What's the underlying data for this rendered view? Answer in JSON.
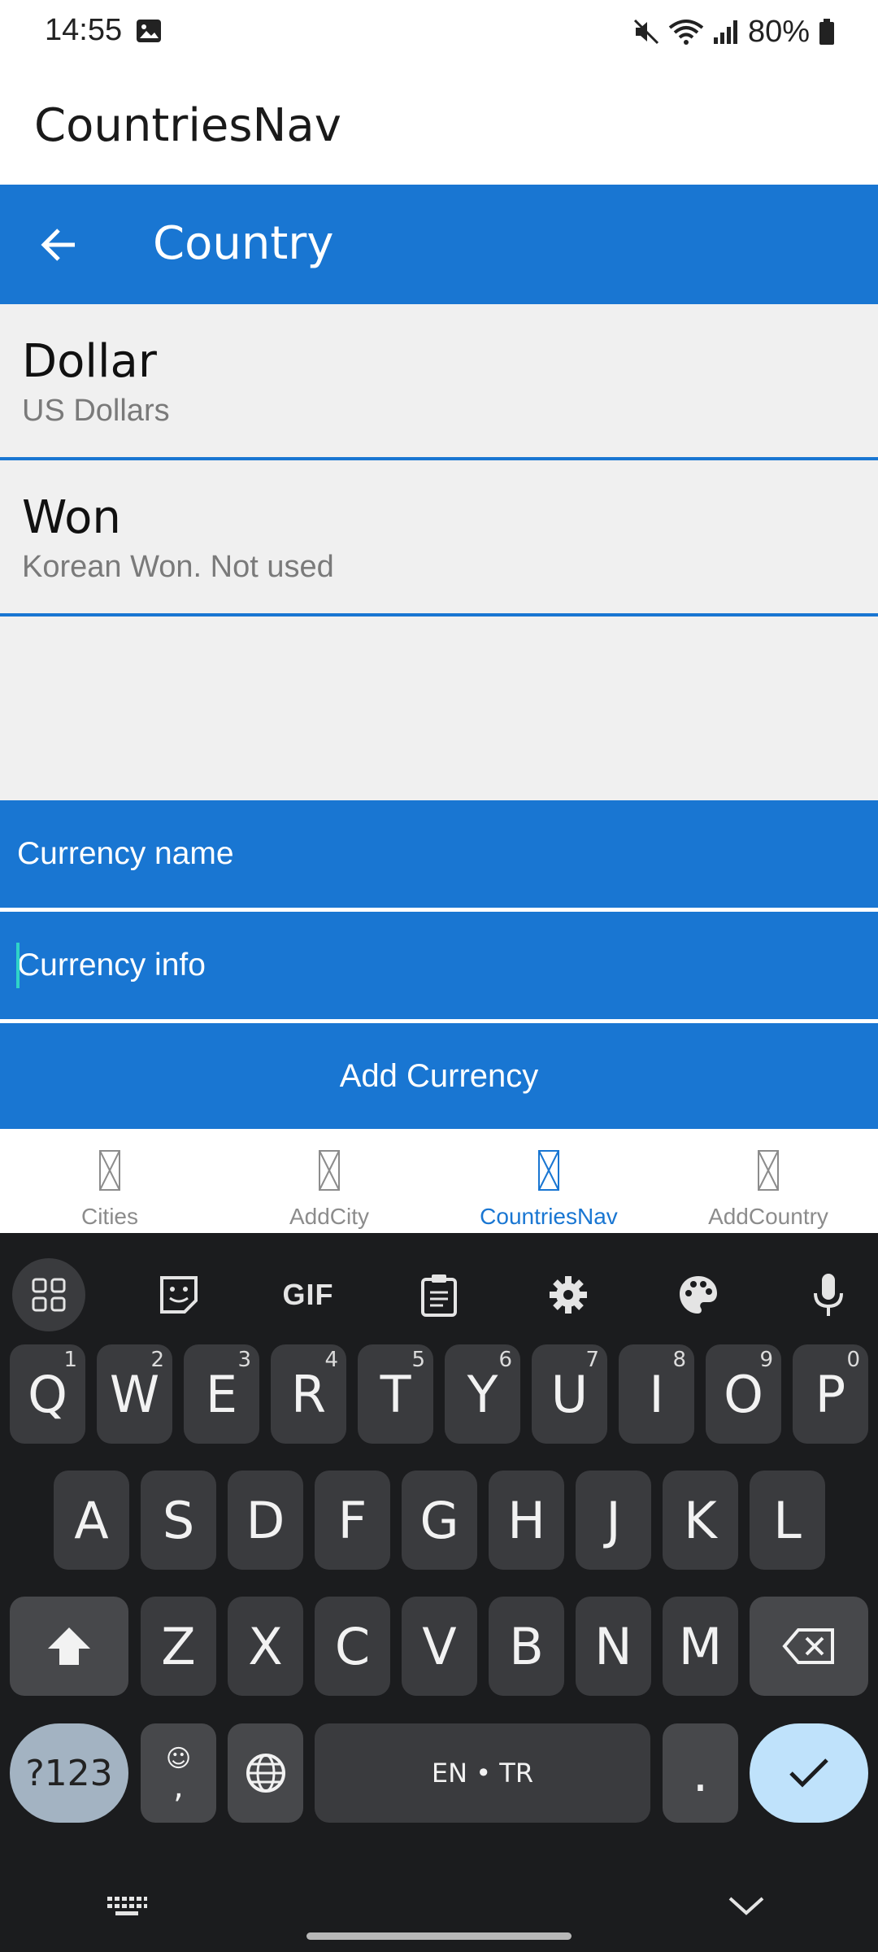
{
  "status_bar": {
    "time": "14:55",
    "battery": "80%"
  },
  "app": {
    "title": "CountriesNav"
  },
  "toolbar": {
    "title": "Country"
  },
  "currencies": [
    {
      "name": "Dollar",
      "info": "US Dollars"
    },
    {
      "name": "Won",
      "info": "Korean Won. Not used"
    }
  ],
  "form": {
    "name_placeholder": "Currency name",
    "info_placeholder": "Currency info",
    "add_label": "Add Currency"
  },
  "bottom_nav": {
    "items": [
      {
        "label": "Cities"
      },
      {
        "label": "AddCity"
      },
      {
        "label": "CountriesNav"
      },
      {
        "label": "AddCountry"
      }
    ],
    "active": "CountriesNav"
  },
  "keyboard": {
    "toolbar": {
      "gif": "GIF"
    },
    "row1": [
      "Q",
      "W",
      "E",
      "R",
      "T",
      "Y",
      "U",
      "I",
      "O",
      "P"
    ],
    "row1_hints": [
      "1",
      "2",
      "3",
      "4",
      "5",
      "6",
      "7",
      "8",
      "9",
      "0"
    ],
    "row2": [
      "A",
      "S",
      "D",
      "F",
      "G",
      "H",
      "J",
      "K",
      "L"
    ],
    "row3": [
      "Z",
      "X",
      "C",
      "V",
      "B",
      "N",
      "M"
    ],
    "symbols": "?123",
    "comma": ",",
    "emoji": "☺",
    "space": "EN • TR",
    "period": "."
  },
  "colors": {
    "primary": "#1976d2",
    "list_bg": "#f0f0f0",
    "keyboard_bg": "#1b1c1e"
  }
}
